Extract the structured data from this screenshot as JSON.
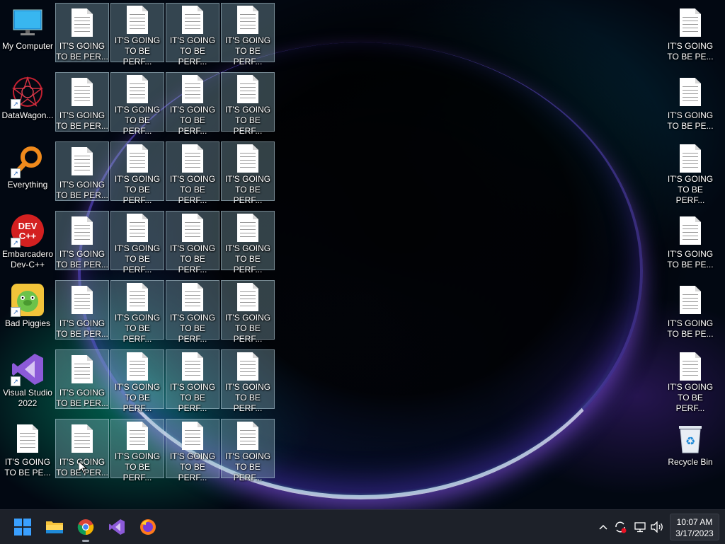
{
  "desktop": {
    "left_icons": [
      {
        "label": "My Computer",
        "icon": "monitor-icon",
        "shortcut": false
      },
      {
        "label": "DataWagon...",
        "icon": "datawagon-icon",
        "shortcut": true
      },
      {
        "label": "Everything",
        "icon": "magnifier-icon",
        "shortcut": true
      },
      {
        "label": "Embarcadero\nDev-C++",
        "icon": "devcpp-icon",
        "shortcut": true
      },
      {
        "label": "Bad Piggies",
        "icon": "pig-icon",
        "shortcut": true
      },
      {
        "label": "Visual Studio\n2022",
        "icon": "visual-studio-icon",
        "shortcut": true
      },
      {
        "label": "IT'S GOING\nTO BE PE...",
        "icon": "document-icon",
        "shortcut": false
      }
    ],
    "file_grid": {
      "col1_label": "IT'S GOING\nTO BE PER...",
      "col_other_label": "IT'S GOING\nTO BE PERF...",
      "col_other_label_alt": "IT'S GOING\nTO BE PERF...",
      "rows": 7,
      "cols": 4
    },
    "right_icons": [
      {
        "label": "IT'S GOING\nTO BE PE..."
      },
      {
        "label": "IT'S GOING\nTO BE PE..."
      },
      {
        "label": "IT'S GOING\nTO BE PERF..."
      },
      {
        "label": "IT'S GOING\nTO BE PE..."
      },
      {
        "label": "IT'S GOING\nTO BE PE..."
      },
      {
        "label": "IT'S GOING\nTO BE PERF..."
      },
      {
        "label": "Recycle Bin"
      }
    ]
  },
  "taskbar": {
    "apps": [
      {
        "name": "start-button",
        "icon": "windows-logo-icon"
      },
      {
        "name": "file-explorer-button",
        "icon": "folder-icon"
      },
      {
        "name": "chrome-button",
        "icon": "chrome-icon",
        "running": true
      },
      {
        "name": "visual-studio-button",
        "icon": "visual-studio-icon"
      },
      {
        "name": "firefox-button",
        "icon": "firefox-icon"
      }
    ],
    "tray": {
      "chevron": "^",
      "time": "10:07 AM",
      "date": "3/17/2023"
    }
  }
}
